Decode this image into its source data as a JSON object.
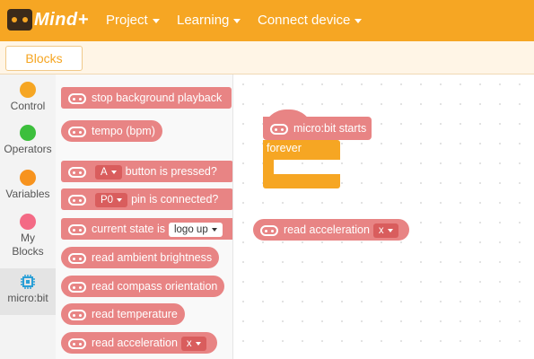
{
  "app": {
    "name": "Mind+"
  },
  "menu": [
    {
      "label": "Project"
    },
    {
      "label": "Learning"
    },
    {
      "label": "Connect device"
    }
  ],
  "tabs": {
    "blocks": "Blocks"
  },
  "categories": [
    {
      "label": "Control",
      "color": "#f6a623"
    },
    {
      "label": "Operators",
      "color": "#3cbf3c"
    },
    {
      "label": "Variables",
      "color": "#f7931e"
    },
    {
      "label": "My Blocks",
      "color": "#f36a85"
    },
    {
      "label": "micro:bit",
      "color": "#2a9fd6"
    }
  ],
  "palette": {
    "stop_bg": "stop background playback",
    "tempo": "tempo (bpm)",
    "button_key": "A",
    "button_text": "button is pressed?",
    "pin_key": "P0",
    "pin_text": "pin is connected?",
    "state_text": "current state is",
    "state_value": "logo up",
    "ambient": "read ambient brightness",
    "compass": "read compass orientation",
    "temperature": "read temperature",
    "accel_text": "read acceleration",
    "accel_axis": "x"
  },
  "workspace": {
    "hat_label": "micro:bit starts",
    "forever_label": "forever",
    "accel_text": "read acceleration",
    "accel_axis": "x"
  }
}
